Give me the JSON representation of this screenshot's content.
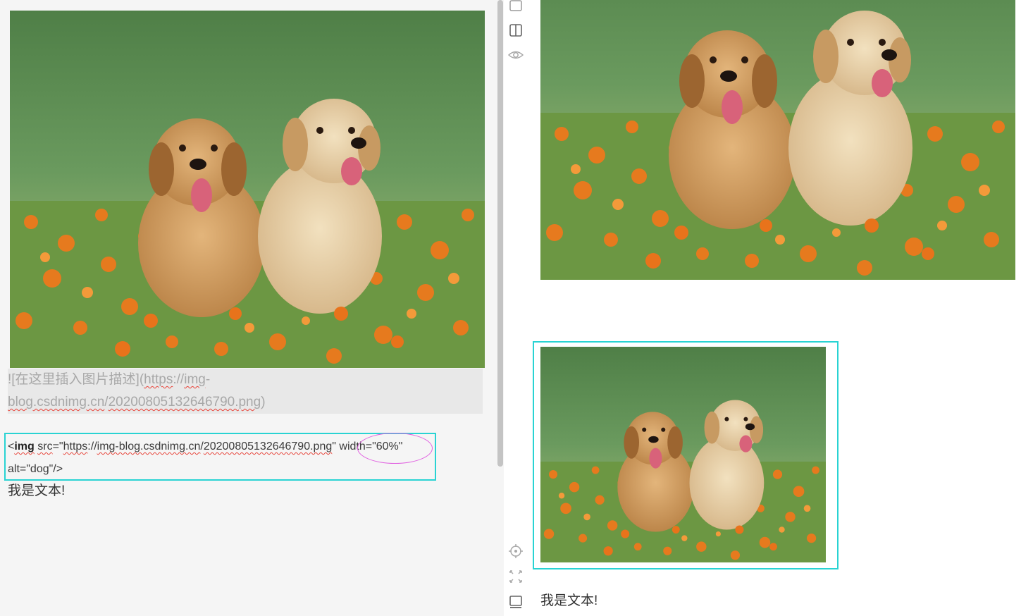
{
  "editor": {
    "markdown_line1_a": "![在这里插入图片描述](",
    "markdown_line1_b": "https",
    "markdown_line1_c": "://",
    "markdown_line1_d": "img",
    "markdown_line1_e": "-",
    "markdown_line2_a": "blog.csdnimg.cn",
    "markdown_line2_b": "/",
    "markdown_line2_c": "20200805132646790.png",
    "markdown_line2_d": ")",
    "html_line1": {
      "lt": "<",
      "tag": "img",
      "sp1": " ",
      "attr_src": "src",
      "eq1": "=\"",
      "url_https": "https",
      "url_sep": "://",
      "url_host": "img-blog.csdnimg.cn",
      "url_slash": "/",
      "url_file": "20200805132646790.png",
      "quote": "\"",
      "width_attr": " width=\"60%\""
    },
    "html_line2": "alt=\"dog\"/>",
    "body_text": "我是文本!"
  },
  "preview": {
    "body_text": "我是文本!"
  },
  "colors": {
    "highlight_box": "#29d3d3",
    "ellipse": "#e05fe0",
    "spellcheck": "#e8443a"
  },
  "icons": {
    "toolbar": [
      "fullscreen-icon",
      "split-view-icon",
      "preview-eye-icon",
      "locate-icon",
      "scroll-sync-icon",
      "toc-icon"
    ]
  }
}
